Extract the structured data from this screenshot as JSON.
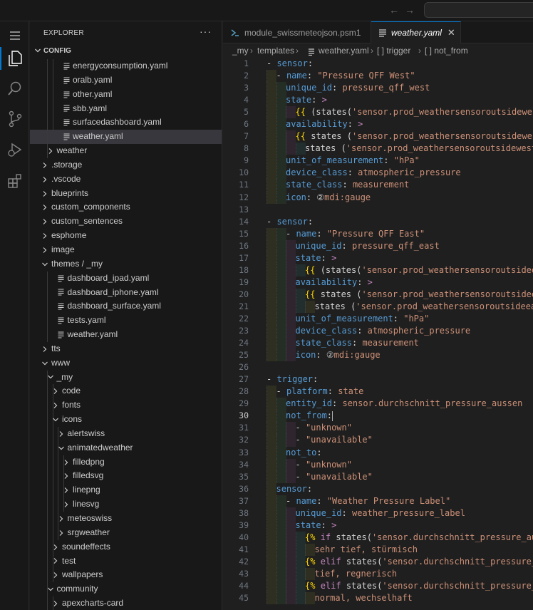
{
  "sidebar": {
    "title": "EXPLORER",
    "more": "···",
    "section": "CONFIG",
    "items": [
      {
        "label": "energyconsumption.yaml",
        "depth": 3,
        "type": "file"
      },
      {
        "label": "oralb.yaml",
        "depth": 3,
        "type": "file"
      },
      {
        "label": "other.yaml",
        "depth": 3,
        "type": "file"
      },
      {
        "label": "sbb.yaml",
        "depth": 3,
        "type": "file"
      },
      {
        "label": "surfacedashboard.yaml",
        "depth": 3,
        "type": "file"
      },
      {
        "label": "weather.yaml",
        "depth": 3,
        "type": "file",
        "selected": true
      },
      {
        "label": "weather",
        "depth": 2,
        "type": "folder",
        "open": false
      },
      {
        "label": ".storage",
        "depth": 1,
        "type": "folder",
        "open": false
      },
      {
        "label": ".vscode",
        "depth": 1,
        "type": "folder",
        "open": false
      },
      {
        "label": "blueprints",
        "depth": 1,
        "type": "folder",
        "open": false
      },
      {
        "label": "custom_components",
        "depth": 1,
        "type": "folder",
        "open": false
      },
      {
        "label": "custom_sentences",
        "depth": 1,
        "type": "folder",
        "open": false
      },
      {
        "label": "esphome",
        "depth": 1,
        "type": "folder",
        "open": false
      },
      {
        "label": "image",
        "depth": 1,
        "type": "folder",
        "open": false
      },
      {
        "label": "themes / _my",
        "depth": 1,
        "type": "folder",
        "open": true
      },
      {
        "label": "dashboard_ipad.yaml",
        "depth": 2,
        "type": "file"
      },
      {
        "label": "dashboard_iphone.yaml",
        "depth": 2,
        "type": "file"
      },
      {
        "label": "dashboard_surface.yaml",
        "depth": 2,
        "type": "file"
      },
      {
        "label": "tests.yaml",
        "depth": 2,
        "type": "file"
      },
      {
        "label": "weather.yaml",
        "depth": 2,
        "type": "file"
      },
      {
        "label": "tts",
        "depth": 1,
        "type": "folder",
        "open": false
      },
      {
        "label": "www",
        "depth": 1,
        "type": "folder",
        "open": true
      },
      {
        "label": "_my",
        "depth": 2,
        "type": "folder",
        "open": true
      },
      {
        "label": "code",
        "depth": 3,
        "type": "folder",
        "open": false
      },
      {
        "label": "fonts",
        "depth": 3,
        "type": "folder",
        "open": false
      },
      {
        "label": "icons",
        "depth": 3,
        "type": "folder",
        "open": true
      },
      {
        "label": "alertswiss",
        "depth": 4,
        "type": "folder",
        "open": false
      },
      {
        "label": "animatedweather",
        "depth": 4,
        "type": "folder",
        "open": true
      },
      {
        "label": "filledpng",
        "depth": 5,
        "type": "folder",
        "open": false
      },
      {
        "label": "filledsvg",
        "depth": 5,
        "type": "folder",
        "open": false
      },
      {
        "label": "linepng",
        "depth": 5,
        "type": "folder",
        "open": false
      },
      {
        "label": "linesvg",
        "depth": 5,
        "type": "folder",
        "open": false
      },
      {
        "label": "meteoswiss",
        "depth": 4,
        "type": "folder",
        "open": false
      },
      {
        "label": "srgweather",
        "depth": 4,
        "type": "folder",
        "open": false
      },
      {
        "label": "soundeffects",
        "depth": 3,
        "type": "folder",
        "open": false
      },
      {
        "label": "test",
        "depth": 3,
        "type": "folder",
        "open": false
      },
      {
        "label": "wallpapers",
        "depth": 3,
        "type": "folder",
        "open": false
      },
      {
        "label": "community",
        "depth": 2,
        "type": "folder",
        "open": true
      },
      {
        "label": "apexcharts-card",
        "depth": 3,
        "type": "folder",
        "open": false
      }
    ]
  },
  "tabs": [
    {
      "label": "module_swissmeteojson.psm1",
      "active": false,
      "icon": "powershell-icon"
    },
    {
      "label": "weather.yaml",
      "active": true,
      "icon": "lines-icon"
    }
  ],
  "tab_close": "✕",
  "breadcrumb": [
    "_my",
    "templates",
    "weather.yaml",
    "[ ] trigger",
    "[ ] not_from"
  ],
  "current_line": 30,
  "code": [
    {
      "n": 1,
      "i": 0,
      "t": [
        [
          "p",
          "- "
        ],
        [
          "k",
          "sensor"
        ],
        [
          "p",
          ":"
        ]
      ]
    },
    {
      "n": 2,
      "i": 1,
      "t": [
        [
          "p",
          "- "
        ],
        [
          "k",
          "name"
        ],
        [
          "p",
          ": "
        ],
        [
          "s",
          "\"Pressure QFF West\""
        ]
      ]
    },
    {
      "n": 3,
      "i": 2,
      "t": [
        [
          "k",
          "unique_id"
        ],
        [
          "p",
          ": "
        ],
        [
          "s",
          "pressure_qff_west"
        ]
      ]
    },
    {
      "n": 4,
      "i": 2,
      "t": [
        [
          "k",
          "state"
        ],
        [
          "p",
          ": "
        ],
        [
          "d",
          ">"
        ]
      ]
    },
    {
      "n": 5,
      "i": 3,
      "t": [
        [
          "b",
          "{{ "
        ],
        [
          "p",
          "(states("
        ],
        [
          "s",
          "'sensor.prod_weathersensoroutsidewest"
        ]
      ]
    },
    {
      "n": 6,
      "i": 2,
      "t": [
        [
          "k",
          "availability"
        ],
        [
          "p",
          ": "
        ],
        [
          "d",
          ">"
        ]
      ]
    },
    {
      "n": 7,
      "i": 3,
      "t": [
        [
          "b",
          "{{ "
        ],
        [
          "p",
          "states ("
        ],
        [
          "s",
          "'sensor.prod_weathersensoroutsidewest"
        ]
      ]
    },
    {
      "n": 8,
      "i": 4,
      "t": [
        [
          "p",
          "states ("
        ],
        [
          "s",
          "'sensor.prod_weathersensoroutsidewest_"
        ]
      ]
    },
    {
      "n": 9,
      "i": 2,
      "t": [
        [
          "k",
          "unit_of_measurement"
        ],
        [
          "p",
          ": "
        ],
        [
          "s",
          "\"hPa\""
        ]
      ]
    },
    {
      "n": 10,
      "i": 2,
      "t": [
        [
          "k",
          "device_class"
        ],
        [
          "p",
          ": "
        ],
        [
          "s",
          "atmospheric_pressure"
        ]
      ]
    },
    {
      "n": 11,
      "i": 2,
      "t": [
        [
          "k",
          "state_class"
        ],
        [
          "p",
          ": "
        ],
        [
          "s",
          "measurement"
        ]
      ]
    },
    {
      "n": 12,
      "i": 2,
      "t": [
        [
          "k",
          "icon"
        ],
        [
          "p",
          ": "
        ],
        [
          "p",
          "②"
        ],
        [
          "s",
          "mdi:gauge"
        ]
      ]
    },
    {
      "n": 13,
      "i": 0,
      "t": []
    },
    {
      "n": 14,
      "i": 0,
      "t": [
        [
          "p",
          "- "
        ],
        [
          "k",
          "sensor"
        ],
        [
          "p",
          ":"
        ]
      ]
    },
    {
      "n": 15,
      "i": 2,
      "t": [
        [
          "p",
          "- "
        ],
        [
          "k",
          "name"
        ],
        [
          "p",
          ": "
        ],
        [
          "s",
          "\"Pressure QFF East\""
        ]
      ]
    },
    {
      "n": 16,
      "i": 3,
      "t": [
        [
          "k",
          "unique_id"
        ],
        [
          "p",
          ": "
        ],
        [
          "s",
          "pressure_qff_east"
        ]
      ]
    },
    {
      "n": 17,
      "i": 3,
      "t": [
        [
          "k",
          "state"
        ],
        [
          "p",
          ": "
        ],
        [
          "d",
          ">"
        ]
      ]
    },
    {
      "n": 18,
      "i": 4,
      "t": [
        [
          "b",
          "{{ "
        ],
        [
          "p",
          "(states("
        ],
        [
          "s",
          "'sensor.prod_weathersensoroutsideea"
        ]
      ]
    },
    {
      "n": 19,
      "i": 3,
      "t": [
        [
          "k",
          "availability"
        ],
        [
          "p",
          ": "
        ],
        [
          "d",
          ">"
        ]
      ]
    },
    {
      "n": 20,
      "i": 4,
      "t": [
        [
          "b",
          "{{ "
        ],
        [
          "p",
          "states ("
        ],
        [
          "s",
          "'sensor.prod_weathersensoroutsideea"
        ]
      ]
    },
    {
      "n": 21,
      "i": 5,
      "t": [
        [
          "p",
          "states ("
        ],
        [
          "s",
          "'sensor.prod_weathersensoroutsideeas"
        ]
      ]
    },
    {
      "n": 22,
      "i": 3,
      "t": [
        [
          "k",
          "unit_of_measurement"
        ],
        [
          "p",
          ": "
        ],
        [
          "s",
          "\"hPa\""
        ]
      ]
    },
    {
      "n": 23,
      "i": 3,
      "t": [
        [
          "k",
          "device_class"
        ],
        [
          "p",
          ": "
        ],
        [
          "s",
          "atmospheric_pressure"
        ]
      ]
    },
    {
      "n": 24,
      "i": 3,
      "t": [
        [
          "k",
          "state_class"
        ],
        [
          "p",
          ": "
        ],
        [
          "s",
          "measurement"
        ]
      ]
    },
    {
      "n": 25,
      "i": 3,
      "t": [
        [
          "k",
          "icon"
        ],
        [
          "p",
          ": "
        ],
        [
          "p",
          "②"
        ],
        [
          "s",
          "mdi:gauge"
        ]
      ]
    },
    {
      "n": 26,
      "i": 0,
      "t": []
    },
    {
      "n": 27,
      "i": 0,
      "t": [
        [
          "p",
          "- "
        ],
        [
          "k",
          "trigger"
        ],
        [
          "p",
          ":"
        ]
      ]
    },
    {
      "n": 28,
      "i": 1,
      "t": [
        [
          "p",
          "- "
        ],
        [
          "k",
          "platform"
        ],
        [
          "p",
          ": "
        ],
        [
          "s",
          "state"
        ]
      ]
    },
    {
      "n": 29,
      "i": 2,
      "t": [
        [
          "k",
          "entity_id"
        ],
        [
          "p",
          ": "
        ],
        [
          "s",
          "sensor.durchschnitt_pressure_aussen"
        ]
      ]
    },
    {
      "n": 30,
      "i": 2,
      "t": [
        [
          "k",
          "not_from"
        ],
        [
          "p",
          ":"
        ]
      ],
      "cursor": true
    },
    {
      "n": 31,
      "i": 3,
      "t": [
        [
          "p",
          "- "
        ],
        [
          "s",
          "\"unknown\""
        ]
      ]
    },
    {
      "n": 32,
      "i": 3,
      "t": [
        [
          "p",
          "- "
        ],
        [
          "s",
          "\"unavailable\""
        ]
      ]
    },
    {
      "n": 33,
      "i": 2,
      "t": [
        [
          "k",
          "not_to"
        ],
        [
          "p",
          ":"
        ]
      ]
    },
    {
      "n": 34,
      "i": 3,
      "t": [
        [
          "p",
          "- "
        ],
        [
          "s",
          "\"unknown\""
        ]
      ]
    },
    {
      "n": 35,
      "i": 3,
      "t": [
        [
          "p",
          "- "
        ],
        [
          "s",
          "\"unavailable\""
        ]
      ]
    },
    {
      "n": 36,
      "i": 1,
      "t": [
        [
          "k",
          "sensor"
        ],
        [
          "p",
          ":"
        ]
      ]
    },
    {
      "n": 37,
      "i": 2,
      "t": [
        [
          "p",
          "- "
        ],
        [
          "k",
          "name"
        ],
        [
          "p",
          ": "
        ],
        [
          "s",
          "\"Weather Pressure Label\""
        ]
      ]
    },
    {
      "n": 38,
      "i": 3,
      "t": [
        [
          "k",
          "unique_id"
        ],
        [
          "p",
          ": "
        ],
        [
          "s",
          "weather_pressure_label"
        ]
      ]
    },
    {
      "n": 39,
      "i": 3,
      "t": [
        [
          "k",
          "state"
        ],
        [
          "p",
          ": "
        ],
        [
          "d",
          ">"
        ]
      ]
    },
    {
      "n": 40,
      "i": 4,
      "t": [
        [
          "b",
          "{% "
        ],
        [
          "d",
          "if "
        ],
        [
          "p",
          "states("
        ],
        [
          "s",
          "'sensor.durchschnitt_pressure_aus"
        ]
      ]
    },
    {
      "n": 41,
      "i": 5,
      "t": [
        [
          "s",
          "sehr tief, stürmisch"
        ]
      ]
    },
    {
      "n": 42,
      "i": 4,
      "t": [
        [
          "b",
          "{% "
        ],
        [
          "d",
          "elif "
        ],
        [
          "p",
          "states("
        ],
        [
          "s",
          "'sensor.durchschnitt_pressure_a"
        ]
      ]
    },
    {
      "n": 43,
      "i": 5,
      "t": [
        [
          "s",
          "tief, regnerisch"
        ]
      ]
    },
    {
      "n": 44,
      "i": 4,
      "t": [
        [
          "b",
          "{% "
        ],
        [
          "d",
          "elif "
        ],
        [
          "p",
          "states("
        ],
        [
          "s",
          "'sensor.durchschnitt_pressure_a"
        ]
      ]
    },
    {
      "n": 45,
      "i": 5,
      "t": [
        [
          "s",
          "normal, wechselhaft"
        ]
      ]
    }
  ]
}
